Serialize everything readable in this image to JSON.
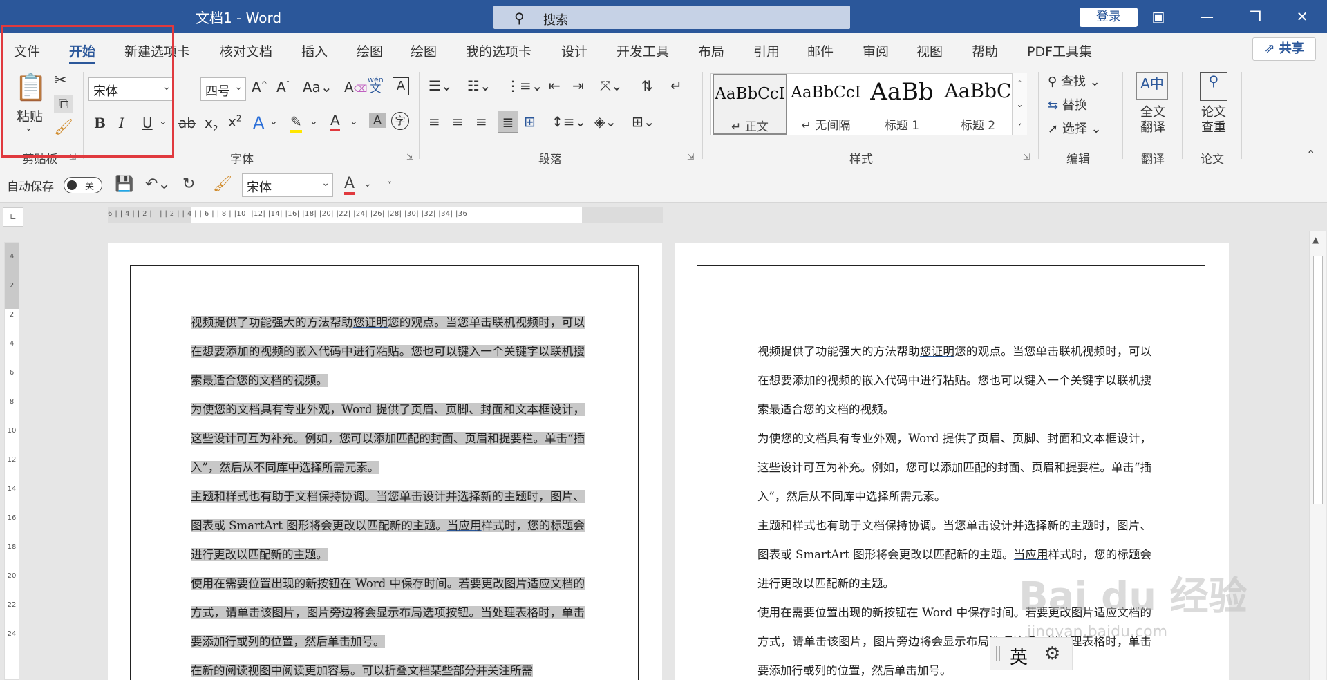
{
  "title_bar": {
    "title": "文档1 - Word",
    "search_placeholder": "搜索",
    "login_label": "登录",
    "ribbon_display_icon": "ribbon-display-icon",
    "minimize": "—",
    "restore": "❐",
    "close": "✕"
  },
  "tabs": [
    "文件",
    "开始",
    "新建选项卡",
    "核对文档",
    "插入",
    "绘图",
    "绘图",
    "我的选项卡",
    "设计",
    "开发工具",
    "布局",
    "引用",
    "邮件",
    "审阅",
    "视图",
    "帮助",
    "PDF工具集"
  ],
  "active_tab": "开始",
  "share_label": "共享",
  "clipboard": {
    "paste_label": "粘贴",
    "group_label": "剪贴板"
  },
  "font": {
    "name": "宋体",
    "size": "四号",
    "group_label": "字体",
    "phonetic_top": "wén",
    "phonetic_bottom": "文"
  },
  "paragraph": {
    "group_label": "段落"
  },
  "styles": {
    "group_label": "样式",
    "items": [
      {
        "preview": "AaBbCcI",
        "name": "↵ 正文"
      },
      {
        "preview": "AaBbCcI",
        "name": "↵ 无间隔"
      },
      {
        "preview": "AaBb",
        "name": "标题 1"
      },
      {
        "preview": "AaBbC",
        "name": "标题 2"
      }
    ]
  },
  "editing": {
    "find": "查找",
    "replace": "替换",
    "select": "选择",
    "group_label": "编辑"
  },
  "translate": {
    "button": "全文\n翻译",
    "group_label": "翻译"
  },
  "paper": {
    "button": "论文\n查重",
    "group_label": "论文"
  },
  "qat": {
    "autosave_label": "自动保存",
    "autosave_state": "关",
    "font_name": "宋体"
  },
  "ruler": {
    "horizontal": "6 |  | 4 |  | 2 |  |  |  | 2 |  | 4 |  | 6 |  | 8 |  |10|  |12|  |14|  |16|  |18|  |20|  |22|  |24|  |26|  |28|  |30|  |32|  |34|  |36",
    "vertical": [
      "4",
      "",
      "2",
      "",
      "",
      "2",
      "4",
      "6",
      "8",
      "10",
      "12",
      "14",
      "16",
      "18",
      "20",
      "22",
      "24"
    ]
  },
  "document": {
    "paragraphs": [
      "视频提供了功能强大的方法帮助您证明您的观点。当您单击联机视频时，可以在想要添加的视频的嵌入代码中进行粘贴。您也可以键入一个关键字以联机搜索最适合您的文档的视频。",
      "为使您的文档具有专业外观，Word 提供了页眉、页脚、封面和文本框设计，这些设计可互为补充。例如，您可以添加匹配的封面、页眉和提要栏。单击“插入”，然后从不同库中选择所需元素。",
      "主题和样式也有助于文档保持协调。当您单击设计并选择新的主题时，图片、图表或 SmartArt 图形将会更改以匹配新的主题。当应用样式时，您的标题会进行更改以匹配新的主题。",
      "使用在需要位置出现的新按钮在 Word 中保存时间。若要更改图片适应文档的方式，请单击该图片，图片旁边将会显示布局选项按钮。当处理表格时，单击要添加行或列的位置，然后单击加号。",
      "在新的阅读视图中阅读更加容易。可以折叠文档某些部分并关注所需"
    ],
    "p1_parts": [
      "视频提供了功能强大的方法帮助",
      "您证明",
      "您的观点。当您单击联机视频时，可以在想要添加的视频的嵌入代码中进行粘贴。您也可以键入一个关键字以联机搜索最适合您的文档的视频。"
    ],
    "p3_parts": [
      "主题和样式也有助于文档保持协调。当您单击设计并选择新的主题时，图片、图表或 SmartArt 图形将会更改以匹配新的主题。",
      "当应用",
      "样式时，您的标题会进行更改以匹配新的主题。"
    ]
  },
  "watermark": {
    "main": "Bai du 经验",
    "sub": "jingyan.baidu.com"
  },
  "ime": {
    "lang": "英"
  },
  "colors": {
    "accent": "#2b579a",
    "highlight": "#c8c8c8",
    "red_box": "#e0393e"
  }
}
